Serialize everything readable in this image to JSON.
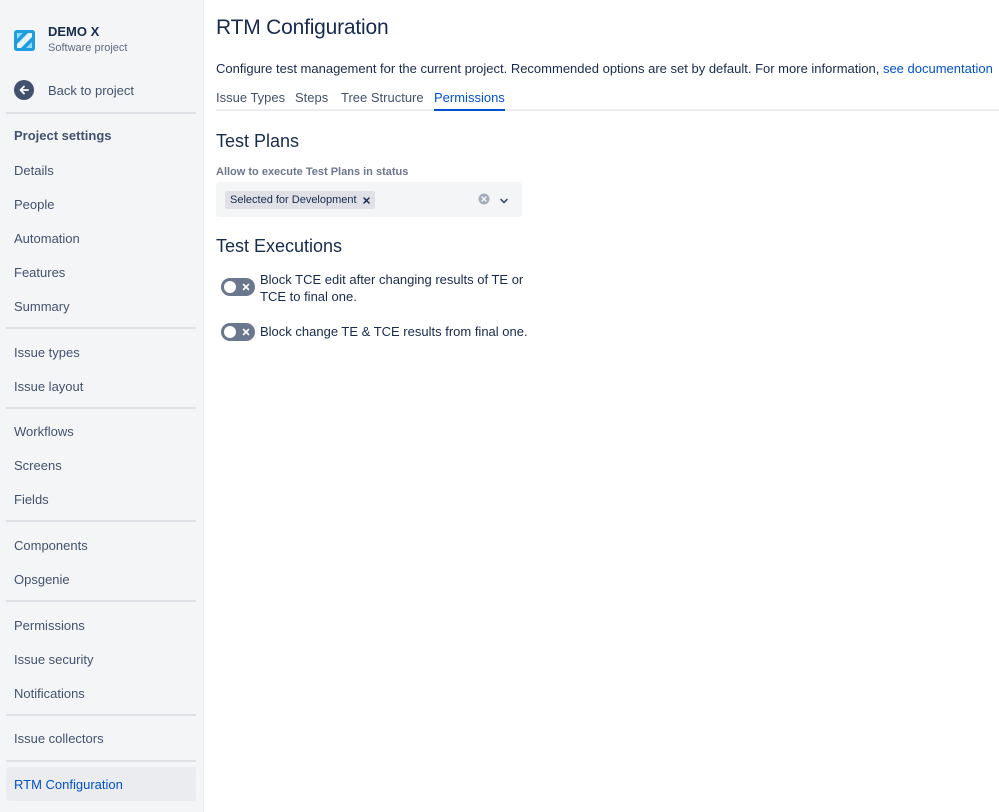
{
  "project": {
    "name": "DEMO X",
    "type": "Software project"
  },
  "sidebar": {
    "back_label": "Back to project",
    "section_title": "Project settings",
    "items": [
      {
        "label": "Details"
      },
      {
        "label": "People"
      },
      {
        "label": "Automation"
      },
      {
        "label": "Features"
      },
      {
        "label": "Summary"
      },
      {
        "label": "Issue types"
      },
      {
        "label": "Issue layout"
      },
      {
        "label": "Workflows"
      },
      {
        "label": "Screens"
      },
      {
        "label": "Fields"
      },
      {
        "label": "Components"
      },
      {
        "label": "Opsgenie"
      },
      {
        "label": "Permissions"
      },
      {
        "label": "Issue security"
      },
      {
        "label": "Notifications"
      },
      {
        "label": "Issue collectors"
      },
      {
        "label": "RTM Configuration",
        "active": true
      }
    ]
  },
  "main": {
    "title": "RTM Configuration",
    "description": "Configure test management for the current project. Recommended options are set by default. For more information, ",
    "doc_link": "see documentation",
    "tabs": [
      {
        "label": "Issue Types"
      },
      {
        "label": "Steps"
      },
      {
        "label": "Tree Structure"
      },
      {
        "label": "Permissions",
        "active": true
      }
    ],
    "test_plans": {
      "heading": "Test Plans",
      "field_label": "Allow to execute Test Plans in status",
      "selected_tags": [
        "Selected for Development"
      ]
    },
    "test_executions": {
      "heading": "Test Executions",
      "toggles": [
        {
          "label": "Block TCE edit after changing results of TE or TCE to final one.",
          "enabled": false
        },
        {
          "label": "Block change TE & TCE results from final one.",
          "enabled": false
        }
      ]
    }
  },
  "colors": {
    "accent": "#0052cc",
    "sidebar_bg": "#f4f5f7",
    "toggle_off": "#6b778c"
  },
  "icons": {
    "project_logo": "project-logo-icon",
    "back": "arrow-left-icon",
    "clear": "clear-icon",
    "dropdown": "chevron-down-icon",
    "tag_remove": "close-icon",
    "toggle_off": "close-icon"
  }
}
